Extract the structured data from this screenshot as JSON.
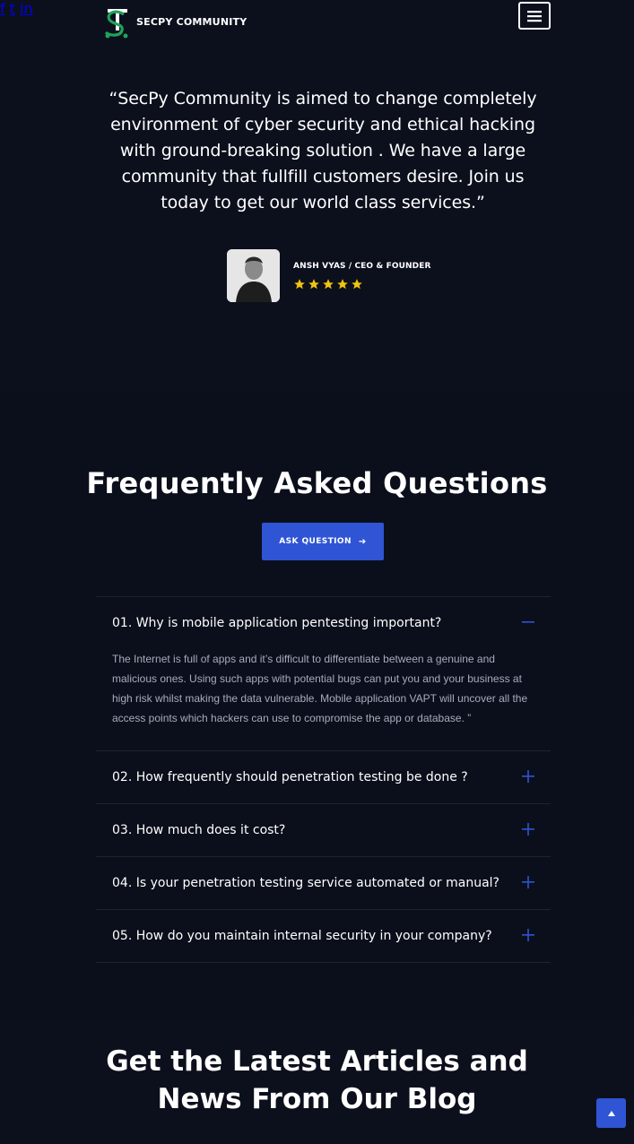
{
  "header": {
    "logo_text": "SECPY COMMUNITY",
    "social": [
      {
        "name": "facebook-icon",
        "glyph": "f"
      },
      {
        "name": "twitter-icon",
        "glyph": "t"
      },
      {
        "name": "linkedin-icon",
        "glyph": "in"
      }
    ]
  },
  "testimonial": {
    "quote": "“SecPy Community is aimed to change completely environment of cyber security and ethical hacking with ground-breaking solution . We have a large community that fullfill customers desire. Join us today to get our world class services.”",
    "author": "ANSH VYAS / CEO & FOUNDER",
    "rating": 5
  },
  "faq": {
    "title": "Frequently Asked Questions",
    "ask_button": "ASK QUESTION",
    "items": [
      {
        "question": "01. Why is mobile application pentesting important?",
        "answer": "The Internet is full of apps and it’s difficult to differentiate between a genuine and malicious ones. Using such apps with potential bugs can put you and your business at high risk whilst making the data vulnerable. Mobile application VAPT will uncover all the access points which hackers can use to compromise the app or database. ”",
        "open": true
      },
      {
        "question": "02. How frequently should penetration testing be done ?",
        "open": false
      },
      {
        "question": "03. How much does it cost?",
        "open": false
      },
      {
        "question": "04. Is your penetration testing service automated or manual?",
        "open": false
      },
      {
        "question": "05. How do you maintain internal security in your company?",
        "open": false
      }
    ]
  },
  "blog": {
    "title_line1": "Get the Latest Articles and",
    "title_line2": "News From Our Blog"
  },
  "colors": {
    "background": "#0c101d",
    "accent": "#2f55d4",
    "star": "#f1c40f",
    "logo_green": "#1fa35a"
  }
}
